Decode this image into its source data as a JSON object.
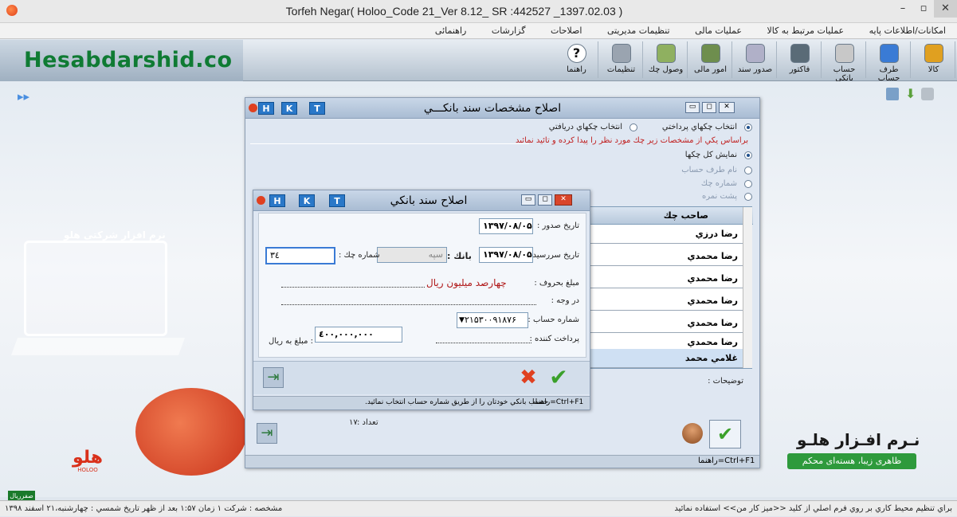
{
  "window": {
    "title": "Torfeh Negar( Holoo_Code 21_Ver 8.12_ SR :442527 _1397.02.03 )"
  },
  "menu": [
    "امکانات/اطلاعات پایه",
    "عملیات مرتبط به کالا",
    "عملیات مالی",
    "تنظیمات مدیریتی",
    "اصلاحات",
    "گزارشات",
    "راهنمائی"
  ],
  "brand": "Hesabdarshid.co",
  "toolbar": [
    {
      "label": "کالا",
      "icon": "box-icon",
      "color": "#e0a020"
    },
    {
      "label": "طرف حساب",
      "icon": "person-icon",
      "color": "#3a7bd5"
    },
    {
      "label": "حساب بانکی",
      "icon": "card-icon",
      "color": "#c8c8c8"
    },
    {
      "label": "فاکتور",
      "icon": "calculator-icon",
      "color": "#5a6b77"
    },
    {
      "label": "صدور سند",
      "icon": "pen-icon",
      "color": "#b0b0c8"
    },
    {
      "label": "امور مالی",
      "icon": "money-icon",
      "color": "#6e8e4e"
    },
    {
      "label": "وصول چك",
      "icon": "check-icon",
      "color": "#8fb060"
    },
    {
      "label": "تنظيمات",
      "icon": "tools-icon",
      "color": "#9aa4b0"
    },
    {
      "label": "راهنما",
      "icon": "help-icon",
      "color": "#ffffff"
    }
  ],
  "outer": {
    "title": "اصلاح مشخصات سند بانکـــي",
    "radio_pay": "انتخاب چکهاي پرداختي",
    "radio_recv": "انتخاب چکهاي دريافتي",
    "hint": "براساس يکي از مشخصات زير چك مورد نظر را پيدا کرده و تائيد نمائيد",
    "opt_all": "نمايش کل چکها",
    "opt_party": "نام طرف حساب",
    "opt_checkno": "شماره چك",
    "opt_back": "پشت نمره",
    "col_owner": "صاحب چك",
    "rows": [
      "رضا درزي",
      "رضا محمدي",
      "رضا محمدي",
      "رضا محمدي",
      "رضا محمدي",
      "رضا محمدي",
      "غلامي محمد"
    ],
    "notes_label": "توضيحات :",
    "count_label": "تعداد :",
    "count_value": "۱۷",
    "help": "راهنما=Ctrl+F1"
  },
  "inner": {
    "title": "اصلاح سند بانکي",
    "issue_label": "تاريخ صدور :",
    "issue_value": "۱۳۹۷/۰۸/۰۵",
    "due_label": "تاريخ سررسيد :",
    "due_value": "۱۳۹۷/۰۸/۰۵",
    "bank_label": "بانك :",
    "bank_value": "سپه",
    "checkno_label": "شماره چك :",
    "checkno_value": "۳٤",
    "words_label": "مبلغ بحروف :",
    "words_value": "چهارصد ميليون ريال",
    "reason_label": "در وجه :",
    "account_label": "شماره حساب :",
    "account_value": "۲۱۵۳۰۰۹۱۸۷۶",
    "payer_label": "پرداخت کننده :",
    "amount_label": ": مبلغ به ريال",
    "amount_value": "٤۰۰,۰۰۰,۰۰۰",
    "help": "راهنما=Ctrl+F1",
    "help_text": "حساب بانکي خودتان را از طريق شماره حساب انتخاب نمائيد."
  },
  "side": {
    "watermark": "نرم افزار شرکتی هلو",
    "logo": "هلو",
    "logo_en": "HOLOO",
    "slogan_title": "نـرم افـزار هلـو",
    "slogan": "ظاهری زیبا، هسته‌ای محکم",
    "corner": "صفرريال"
  },
  "status": {
    "left": "مشخصه : شرکت ۱    زمان ۱:۵۷ بعد از ظهر    تاريخ شمسي : چهارشنبه،۲۱ اسفند ۱۳۹۸",
    "right": "براي تنظيم محيط کاري بر روي فرم اصلي از کليد <<ميز کار من>> استفاده نمائيد"
  },
  "colors": {
    "accent": "#2a78c8",
    "ok": "#3aa02a",
    "cancel": "#e04020",
    "brand": "#0f7b33"
  }
}
